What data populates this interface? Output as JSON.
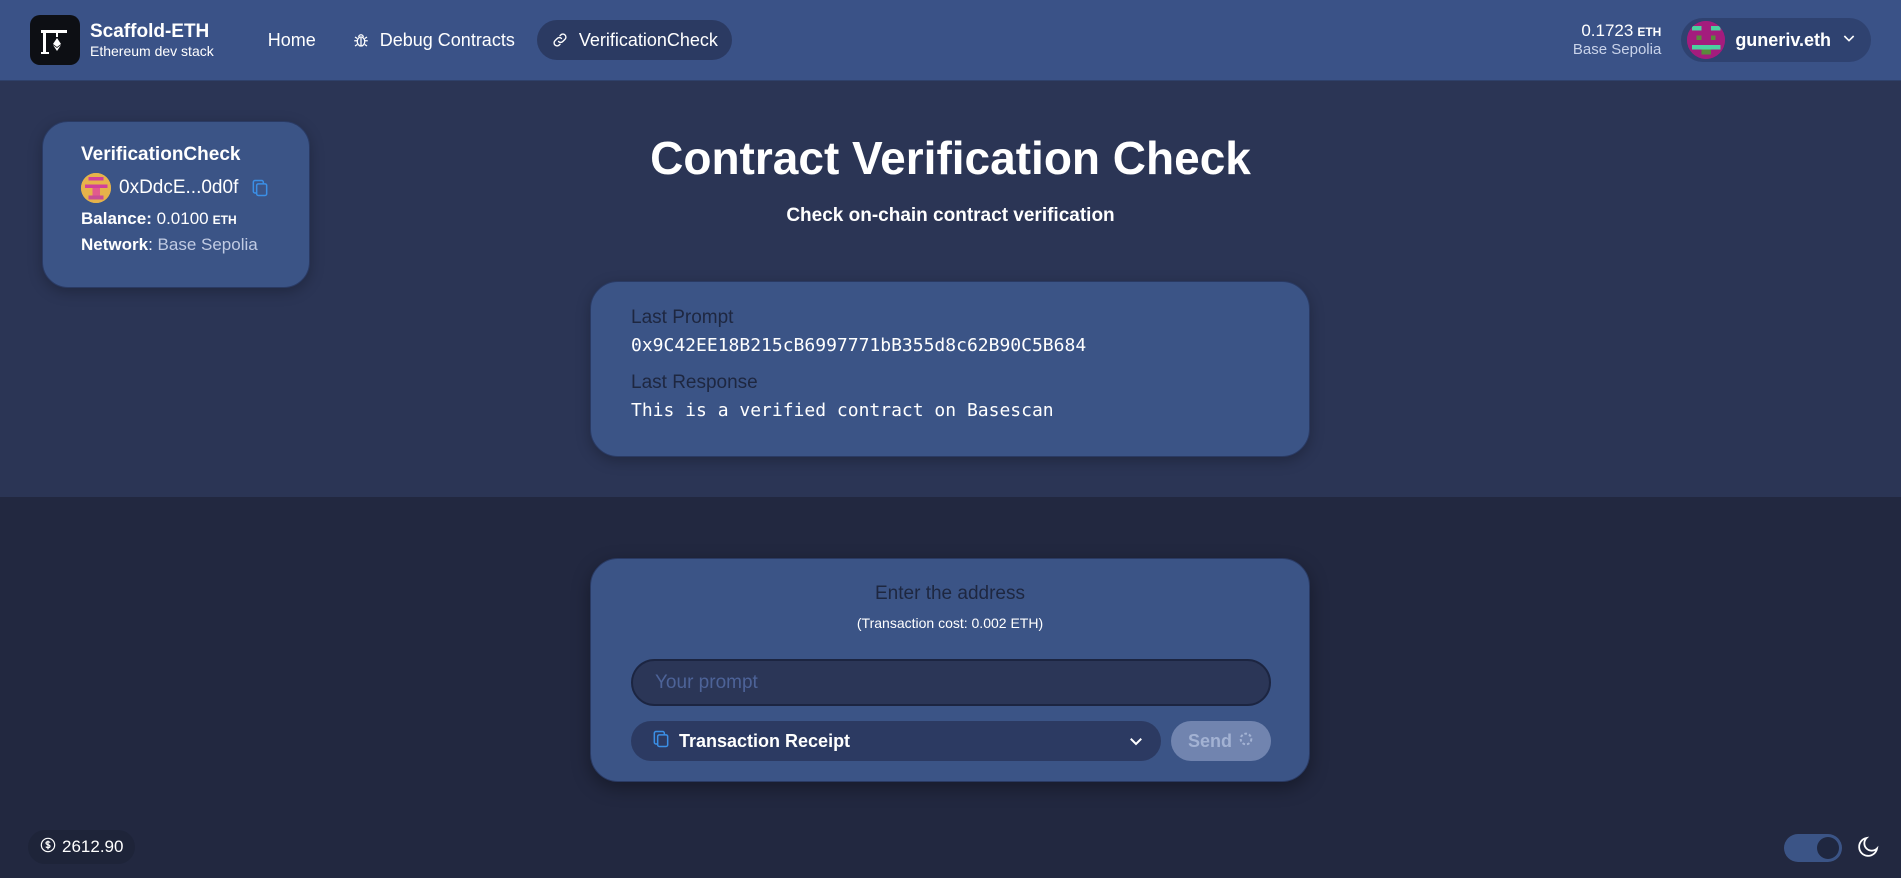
{
  "header": {
    "brand_title": "Scaffold-ETH",
    "brand_subtitle": "Ethereum dev stack",
    "nav": [
      {
        "label": "Home",
        "icon": null
      },
      {
        "label": "Debug Contracts",
        "icon": "bug-icon"
      },
      {
        "label": "VerificationCheck",
        "icon": "link-icon",
        "active": true
      }
    ],
    "wallet": {
      "balance": "0.1723",
      "currency": "ETH",
      "network": "Base Sepolia",
      "account_name": "guneriv.eth"
    }
  },
  "contract": {
    "name": "VerificationCheck",
    "address": "0xDdcE...0d0f",
    "balance_label": "Balance:",
    "balance_value": "0.0100",
    "balance_currency": "ETH",
    "network_label": "Network",
    "network_value": "Base Sepolia"
  },
  "main": {
    "title": "Contract Verification Check",
    "subtitle": "Check on-chain contract verification",
    "last_prompt_label": "Last Prompt",
    "last_prompt_value": "0x9C42EE18B215cB6997771bB355d8c62B90C5B684",
    "last_response_label": "Last Response",
    "last_response_value": "This is a verified contract on Basescan"
  },
  "form": {
    "title": "Enter the address",
    "cost": "(Transaction cost: 0.002 ETH)",
    "input_placeholder": "Your prompt",
    "receipt_label": "Transaction Receipt",
    "send_label": "Send"
  },
  "footer": {
    "eth_price": "2612.90"
  },
  "colors": {
    "header_bg": "#3a5287",
    "upper_bg": "#2b3555",
    "lower_bg": "#222840",
    "card_bg": "#3b5486",
    "accent_blue": "#3b8fe6"
  }
}
